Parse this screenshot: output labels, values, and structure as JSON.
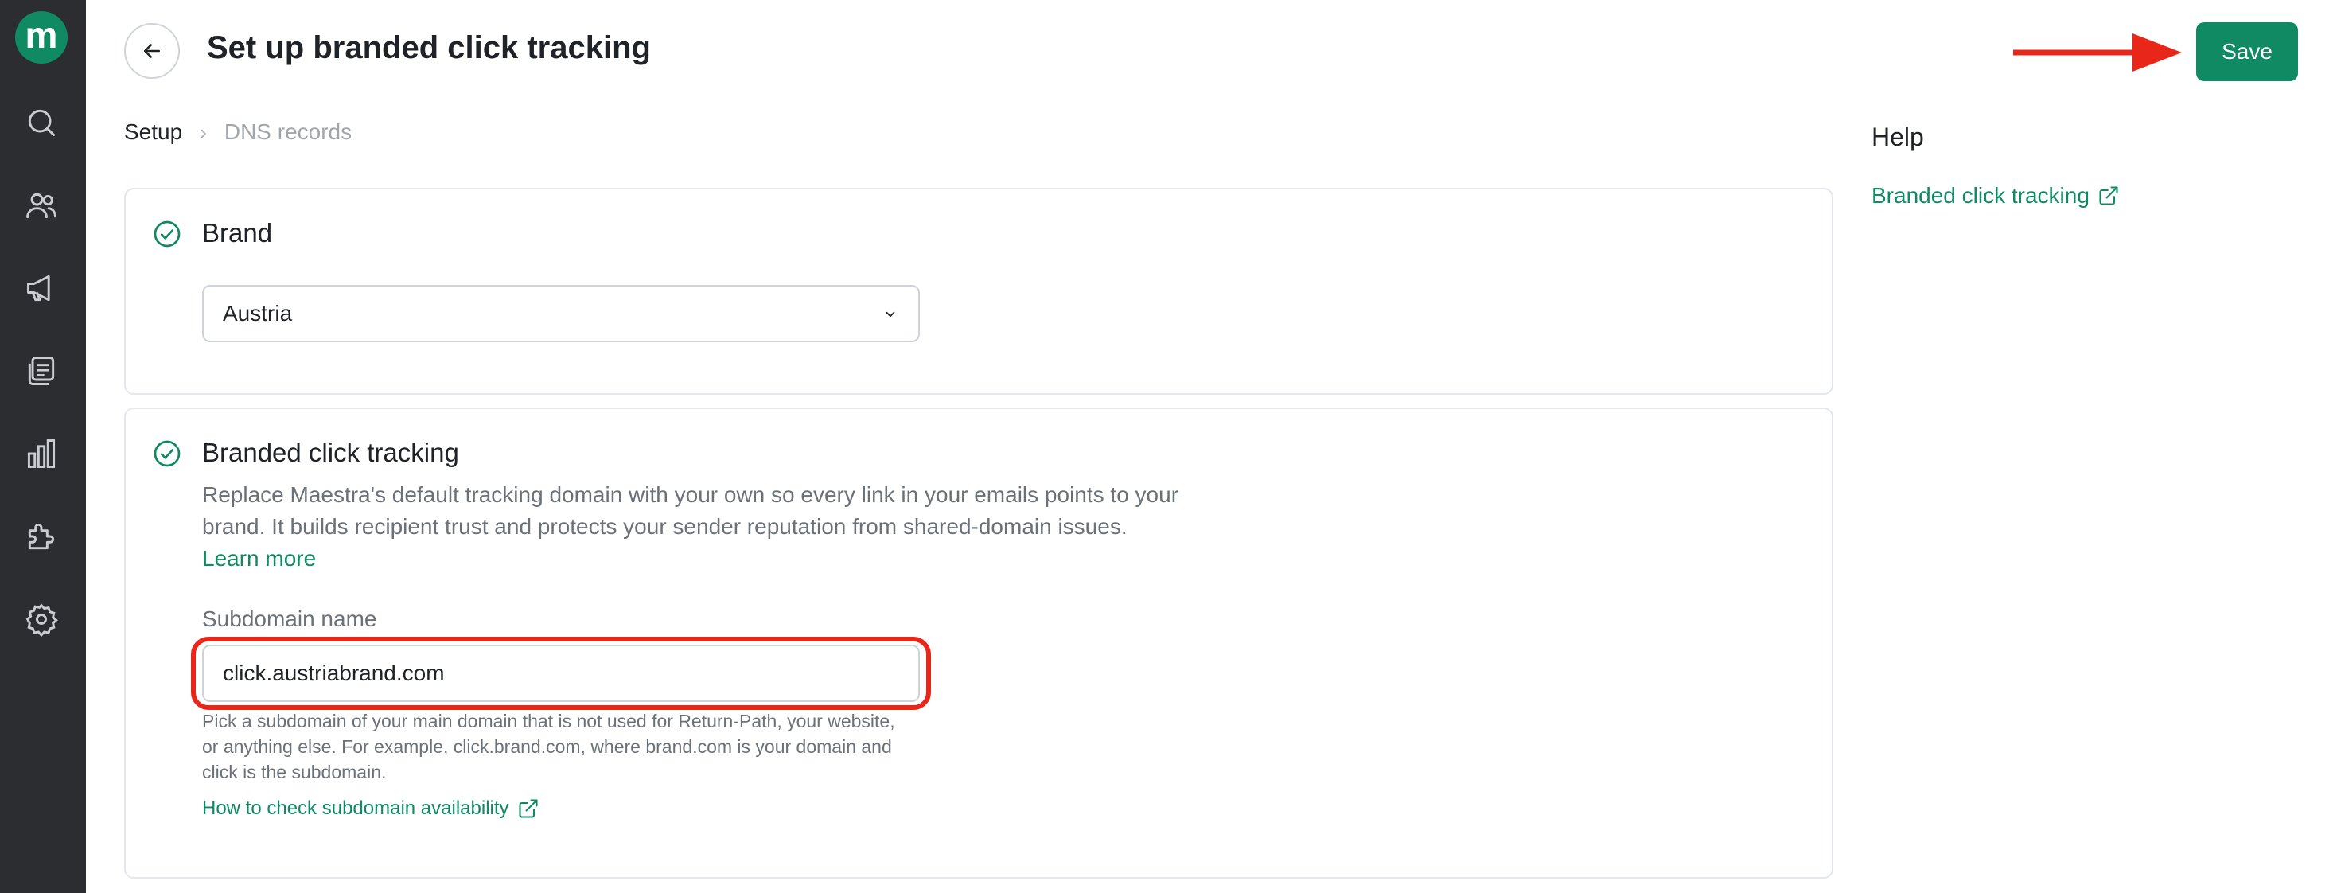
{
  "app": {
    "logo_letter": "m",
    "brand_color": "#0f8a63",
    "sidebar_icons": [
      "search-icon",
      "contacts-icon",
      "campaigns-icon",
      "messages-icon",
      "analytics-icon",
      "integrations-icon",
      "settings-icon"
    ]
  },
  "header": {
    "title": "Set up branded click tracking",
    "save_label": "Save"
  },
  "breadcrumb": {
    "items": [
      "Setup",
      "DNS records"
    ],
    "active_index": 0
  },
  "brand_section": {
    "title": "Brand",
    "selected_value": "Austria"
  },
  "tracking_section": {
    "title": "Branded click tracking",
    "description": "Replace Maestra's default tracking domain with your own so every link in your emails points to your brand. It builds recipient trust and protects your sender reputation from shared-domain issues.",
    "learn_more": "Learn more",
    "field_label": "Subdomain name",
    "field_value": "click.austriabrand.com",
    "hint": "Pick a subdomain of your main domain that is not used for Return-Path, your website, or anything else. For example, click.brand.com, where brand.com is your domain and click is the subdomain.",
    "hint_link": "How to check subdomain availability"
  },
  "help": {
    "title": "Help",
    "link": "Branded click tracking"
  },
  "annotation_color": "#e8271a"
}
